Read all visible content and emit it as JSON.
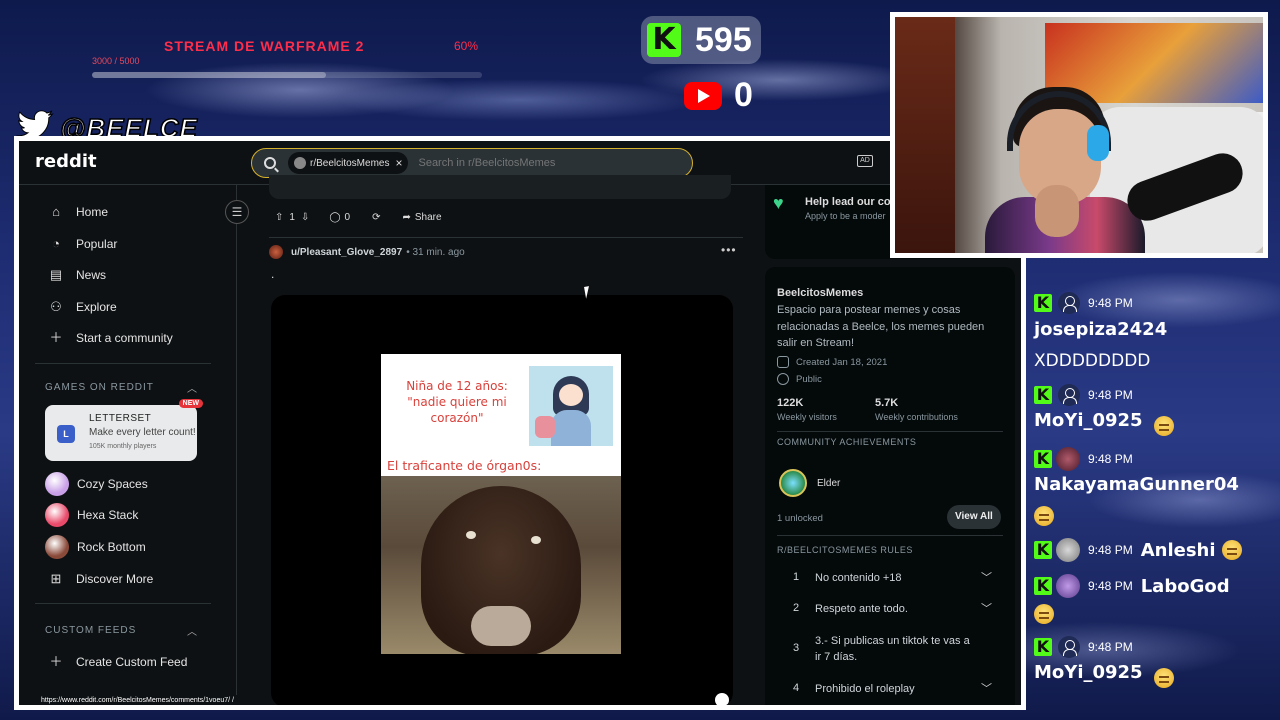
{
  "overlay": {
    "goal_title": "STREAM DE WARFRAME 2",
    "goal_percent": "60%",
    "goal_progress": 0.6,
    "goal_numbers": "3000 / 5000",
    "kick_count": "595",
    "youtube_count": "0",
    "twitter_handle": "@BEELCE_"
  },
  "browser": {
    "logo": "reddit",
    "search": {
      "chip_label": "r/BeelcitosMemes",
      "placeholder": "Search in r/BeelcitosMemes"
    },
    "status_url": "https://www.reddit.com/r/BeelcitosMemes/comments/1voeu7/ /"
  },
  "sidebar": {
    "nav": [
      {
        "label": "Home",
        "icon": "home-icon"
      },
      {
        "label": "Popular",
        "icon": "popular-icon"
      },
      {
        "label": "News",
        "icon": "news-icon"
      },
      {
        "label": "Explore",
        "icon": "explore-icon"
      },
      {
        "label": "Start a community",
        "icon": "plus-icon"
      }
    ],
    "games_section": "GAMES ON REDDIT",
    "letterset": {
      "title": "LETTERSET",
      "subtitle": "Make every letter count!",
      "players": "105K monthly players",
      "badge": "NEW"
    },
    "games": [
      {
        "label": "Cozy Spaces",
        "color": "#c9a0e8"
      },
      {
        "label": "Hexa Stack",
        "color": "#e84a6a"
      },
      {
        "label": "Rock Bottom",
        "color": "#8a4a3a"
      }
    ],
    "discover_more": "Discover More",
    "custom_feeds_section": "CUSTOM FEEDS",
    "create_custom_feed": "Create Custom Feed"
  },
  "feed": {
    "prev_post": {
      "upvotes": "1",
      "comments": "0",
      "share_label": "Share"
    },
    "post": {
      "author": "u/Pleasant_Glove_2897",
      "time": "• 31 min. ago",
      "body": ".",
      "meme_top_text": "Niña de 12 años: \"nadie quiere mi corazón\"",
      "meme_bottom_text": "El traficante de órgan0s:"
    }
  },
  "rightbar": {
    "promo_title": "Help lead our cor",
    "promo_subtitle": "Apply to be a moder",
    "community_name": "BeelcitosMemes",
    "description": "Espacio para postear memes y cosas relacionadas a Beelce, los memes pueden salir en Stream!",
    "created": "Created Jan 18, 2021",
    "visibility": "Public",
    "weekly_visitors": "122K",
    "weekly_visitors_label": "Weekly visitors",
    "weekly_contributions": "5.7K",
    "weekly_contributions_label": "Weekly contributions",
    "achievements_heading": "COMMUNITY ACHIEVEMENTS",
    "achievement_name": "Elder",
    "unlocked": "1 unlocked",
    "view_all": "View All",
    "rules_heading": "R/BEELCITOSMEMES RULES",
    "rules": [
      {
        "num": "1",
        "text": "No contenido +18"
      },
      {
        "num": "2",
        "text": "Respeto ante todo."
      },
      {
        "num": "3",
        "text": "3.- Si publicas un tiktok te vas a ir 7 días."
      },
      {
        "num": "4",
        "text": "Prohibido el roleplay"
      }
    ]
  },
  "chat": [
    {
      "time": "9:48 PM",
      "user": "josepiza2424",
      "text": "XDDDDDDDD"
    },
    {
      "time": "9:48 PM",
      "user": "MoYi_0925"
    },
    {
      "time": "9:48 PM",
      "user": "NakayamaGunner04"
    },
    {
      "time": "9:48 PM",
      "user": "Anleshi"
    },
    {
      "time": "9:48 PM",
      "user": "LaboGod"
    },
    {
      "time": "9:48 PM",
      "user": "MoYi_0925"
    }
  ]
}
